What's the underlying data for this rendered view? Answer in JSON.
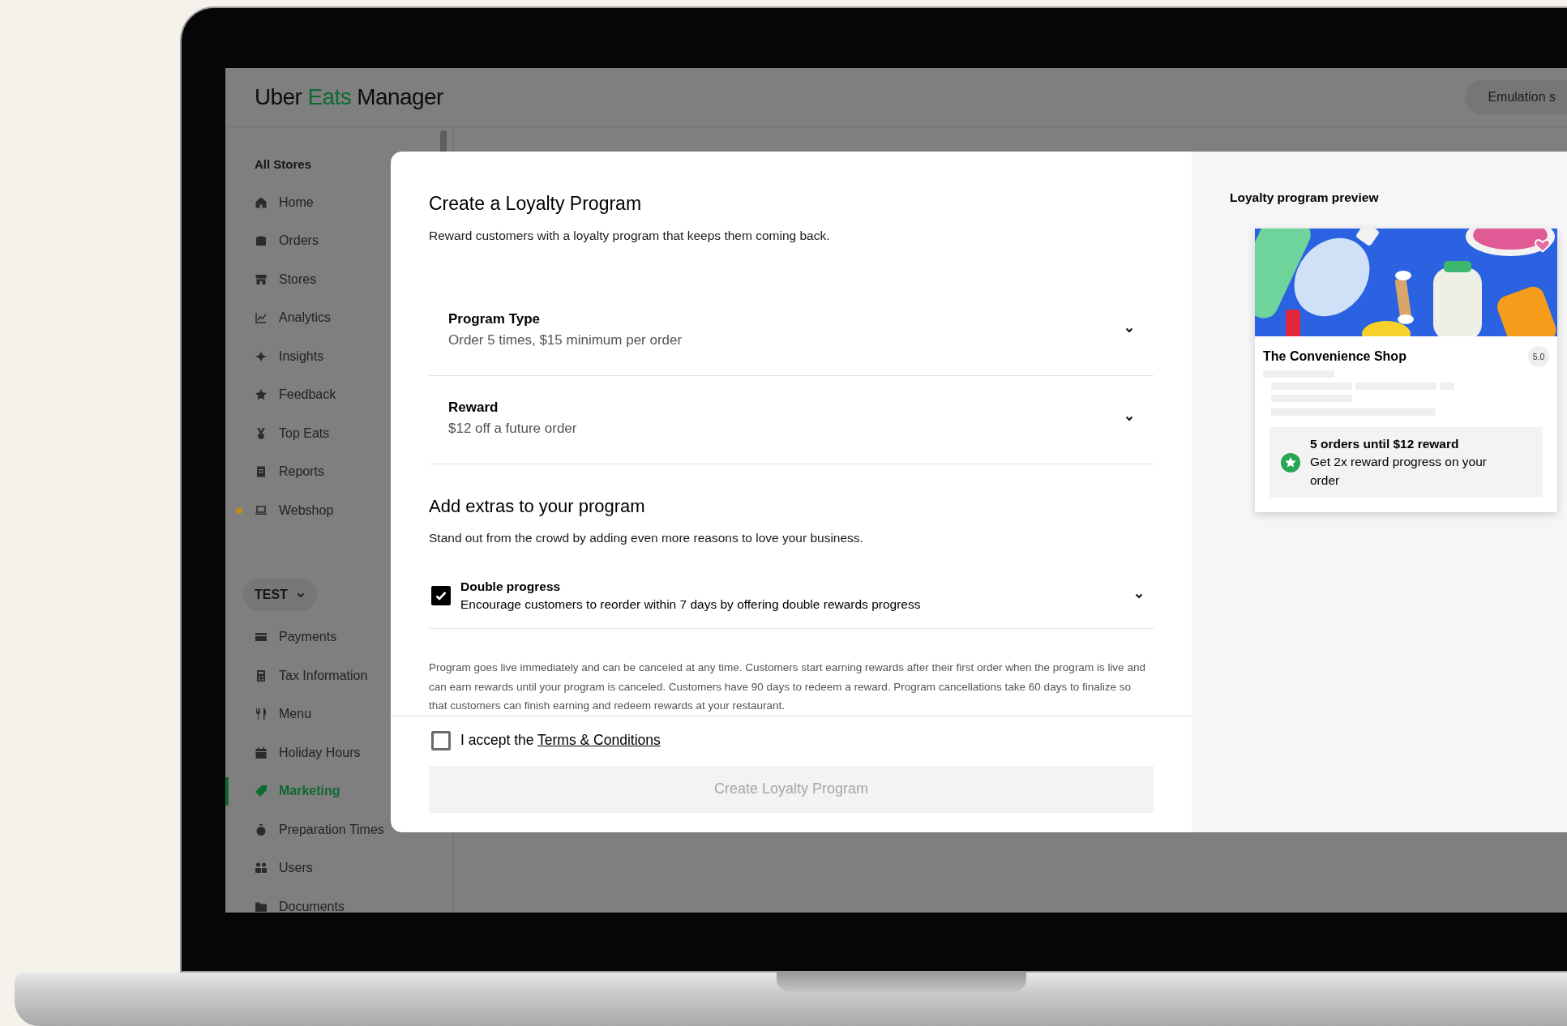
{
  "header": {
    "logo": {
      "brand": "Uber",
      "product": "Eats",
      "suffix": "Manager"
    },
    "emulation_button": "Emulation s"
  },
  "sidebar": {
    "all_stores": "All Stores",
    "items": [
      {
        "label": "Home",
        "selected": false,
        "dot": false
      },
      {
        "label": "Orders",
        "selected": false,
        "dot": false
      },
      {
        "label": "Stores",
        "selected": false,
        "dot": false
      },
      {
        "label": "Analytics",
        "selected": false,
        "dot": false
      },
      {
        "label": "Insights",
        "selected": false,
        "dot": false
      },
      {
        "label": "Feedback",
        "selected": false,
        "dot": false
      },
      {
        "label": "Top Eats",
        "selected": false,
        "dot": false
      },
      {
        "label": "Reports",
        "selected": false,
        "dot": false
      },
      {
        "label": "Webshop",
        "selected": false,
        "dot": true
      }
    ],
    "store_selector": "TEST",
    "store_items": [
      {
        "label": "Payments",
        "selected": false,
        "dot": false
      },
      {
        "label": "Tax Information",
        "selected": false,
        "dot": false
      },
      {
        "label": "Menu",
        "selected": false,
        "dot": false
      },
      {
        "label": "Holiday Hours",
        "selected": false,
        "dot": false
      },
      {
        "label": "Marketing",
        "selected": true,
        "dot": false
      },
      {
        "label": "Preparation Times",
        "selected": false,
        "dot": false
      },
      {
        "label": "Users",
        "selected": false,
        "dot": false
      },
      {
        "label": "Documents",
        "selected": false,
        "dot": false
      }
    ]
  },
  "modal": {
    "title": "Create a Loyalty Program",
    "subtitle": "Reward customers with a loyalty program that keeps them coming back.",
    "settings": [
      {
        "title": "Program Type",
        "value": "Order 5 times, $15 minimum per order"
      },
      {
        "title": "Reward",
        "value": "$12 off a future order"
      }
    ],
    "extras_title": "Add extras to your program",
    "extras_subtitle": "Stand out from the crowd by adding even more reasons to love your business.",
    "extras": [
      {
        "title": "Double progress",
        "description": "Encourage customers to reorder within 7 days by offering double rewards progress",
        "checked": true
      }
    ],
    "disclaimer": "Program goes live immediately and can be canceled at any time. Customers start earning rewards after their first order when the program is live and can earn rewards until your program is canceled. Customers have 90 days to redeem a reward. Program cancellations take 60 days to finalize so that customers can finish earning and redeem rewards at your restaurant.",
    "accept": {
      "text": "I accept the",
      "link": "Terms & Conditions",
      "checked": false
    },
    "submit_button": {
      "label": "Create Loyalty Program",
      "disabled": true
    }
  },
  "preview": {
    "title": "Loyalty program preview",
    "store_name": "The Convenience Shop",
    "rating": "5.0",
    "reward_title": "5 orders until $12 reward",
    "reward_text": "Get 2x reward progress on your order"
  }
}
